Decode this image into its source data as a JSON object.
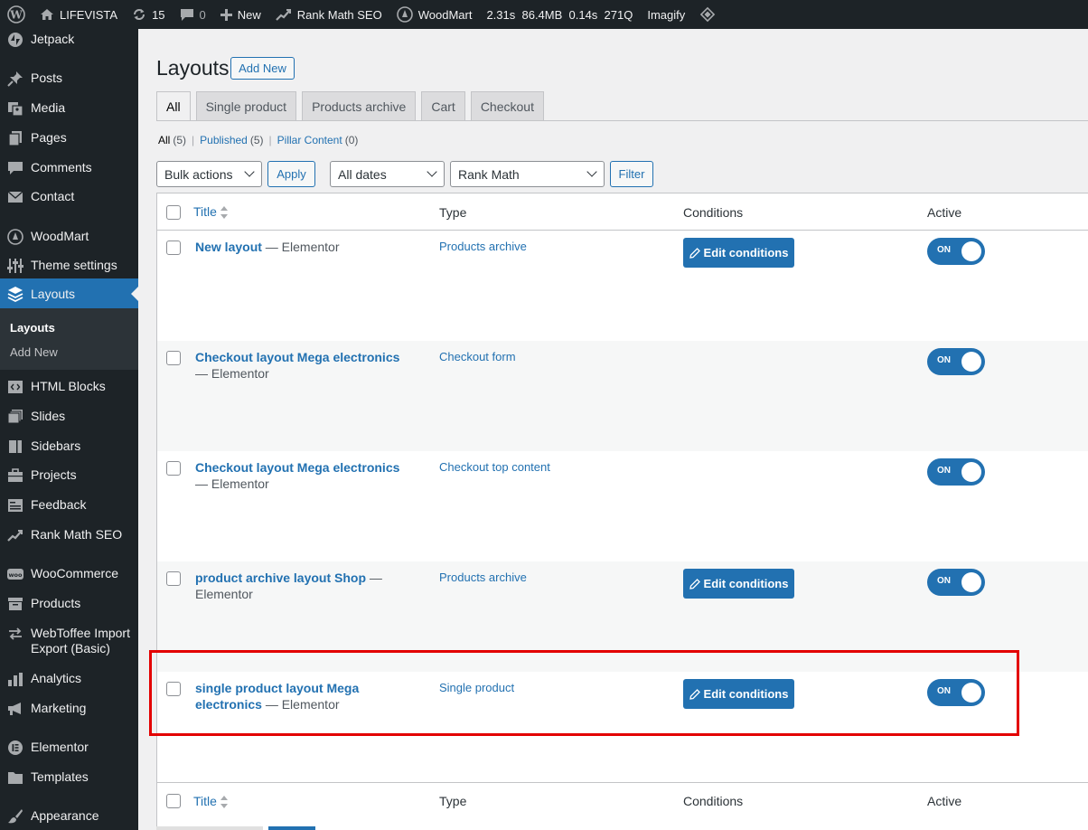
{
  "admin_bar": {
    "site_name": "LIFEVISTA",
    "updates_count": "15",
    "comments_count": "0",
    "new_label": "New",
    "rank_math": "Rank Math SEO",
    "woodmart": "WoodMart",
    "perf": "2.31s  86.4MB  0.14s  271Q",
    "imagify": "Imagify"
  },
  "sidebar": {
    "items": [
      {
        "label": "Jetpack",
        "icon": "jetpack-icon"
      },
      {
        "label": "Posts",
        "icon": "pin-icon"
      },
      {
        "label": "Media",
        "icon": "media-icon"
      },
      {
        "label": "Pages",
        "icon": "pages-icon"
      },
      {
        "label": "Comments",
        "icon": "comment-icon"
      },
      {
        "label": "Contact",
        "icon": "mail-icon"
      },
      {
        "label": "WoodMart",
        "icon": "woodmart-icon"
      },
      {
        "label": "Theme settings",
        "icon": "sliders-icon"
      },
      {
        "label": "Layouts",
        "icon": "layers-icon"
      },
      {
        "label": "HTML Blocks",
        "icon": "code-block-icon"
      },
      {
        "label": "Slides",
        "icon": "slides-icon"
      },
      {
        "label": "Sidebars",
        "icon": "sidebar-icon"
      },
      {
        "label": "Projects",
        "icon": "briefcase-icon"
      },
      {
        "label": "Feedback",
        "icon": "feedback-icon"
      },
      {
        "label": "Rank Math SEO",
        "icon": "chart-icon"
      },
      {
        "label": "WooCommerce",
        "icon": "woo-icon"
      },
      {
        "label": "Products",
        "icon": "archive-icon"
      },
      {
        "label": "WebToffee Import Export (Basic)",
        "icon": "import-export-icon"
      },
      {
        "label": "Analytics",
        "icon": "bar-chart-icon"
      },
      {
        "label": "Marketing",
        "icon": "megaphone-icon"
      },
      {
        "label": "Elementor",
        "icon": "elementor-icon"
      },
      {
        "label": "Templates",
        "icon": "folder-icon"
      },
      {
        "label": "Appearance",
        "icon": "brush-icon"
      }
    ],
    "submenu": {
      "current": "Layouts",
      "add_new": "Add New"
    }
  },
  "page": {
    "title": "Layouts",
    "add_new": "Add New",
    "tabs": [
      "All",
      "Single product",
      "Products archive",
      "Cart",
      "Checkout"
    ],
    "active_tab": "All",
    "views": {
      "all": "All",
      "all_count": "(5)",
      "published": "Published",
      "published_count": "(5)",
      "pillar": "Pillar Content",
      "pillar_count": "(0)"
    },
    "filters": {
      "bulk_actions": "Bulk actions",
      "apply": "Apply",
      "dates": "All dates",
      "rank_math": "Rank Math",
      "filter": "Filter"
    },
    "columns": {
      "title": "Title",
      "type": "Type",
      "conditions": "Conditions",
      "active": "Active"
    },
    "edit_conditions_label": "Edit conditions",
    "toggle_label": "ON",
    "rows": [
      {
        "title": "New layout",
        "builder": "— Elementor",
        "type": "Products archive",
        "has_conditions": true,
        "active": true
      },
      {
        "title": "Checkout layout Mega electronics",
        "builder": "— Elementor",
        "type": "Checkout form",
        "has_conditions": false,
        "active": true
      },
      {
        "title": "Checkout layout Mega electronics",
        "builder": "— Elementor",
        "type": "Checkout top content",
        "has_conditions": false,
        "active": true
      },
      {
        "title": "product archive layout Shop",
        "builder": "— Elementor",
        "type": "Products archive",
        "has_conditions": true,
        "active": true
      },
      {
        "title": "single product layout Mega electronics",
        "builder": "— Elementor",
        "type": "Single product",
        "has_conditions": true,
        "active": true
      }
    ]
  },
  "colors": {
    "accent": "#2271b1",
    "sidebar_bg": "#1d2327",
    "highlight": "#e30000"
  }
}
